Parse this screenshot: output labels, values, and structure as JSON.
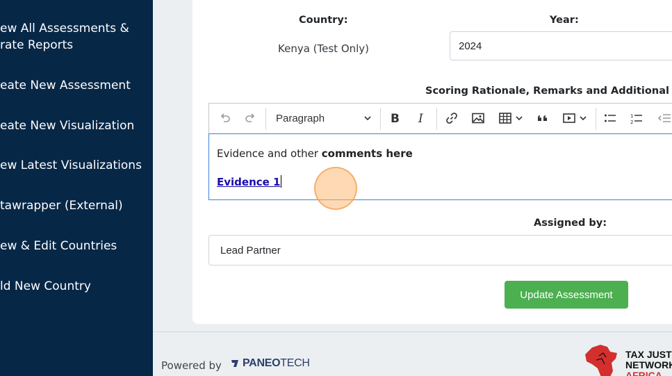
{
  "sidebar": {
    "items": [
      {
        "line1": "ew All Assessments &",
        "line2": "rate Reports"
      },
      {
        "line1": "eate New Assessment"
      },
      {
        "line1": "eate New Visualization"
      },
      {
        "line1": "ew Latest Visualizations"
      },
      {
        "line1": "tawrapper (External)"
      },
      {
        "line1": "ew & Edit Countries"
      },
      {
        "line1": "ld New Country"
      }
    ]
  },
  "form": {
    "country_label": "Country:",
    "country_value": "Kenya (Test Only)",
    "year_label": "Year:",
    "year_value": "2024",
    "rationale_label": "Scoring Rationale, Remarks and Additional Com",
    "assigned_label": "Assigned by:",
    "assigned_value": "Lead Partner",
    "submit_label": "Update Assessment"
  },
  "editor": {
    "paragraph_style": "Paragraph",
    "text_plain": "Evidence and other ",
    "text_bold": "comments here",
    "link_text": "Evidence 1"
  },
  "footer": {
    "powered_by": "Powered by",
    "brand_bold": "PANEO",
    "brand_light": "TECH",
    "partner_line1": "TAX JUSTICE",
    "partner_line2": "NETWORK",
    "partner_line3": "AFRICA"
  },
  "colors": {
    "sidebar_bg": "#072747",
    "submit_bg": "#4caf50",
    "link": "#1a0dab",
    "editor_focus_border": "#3b82d6"
  }
}
